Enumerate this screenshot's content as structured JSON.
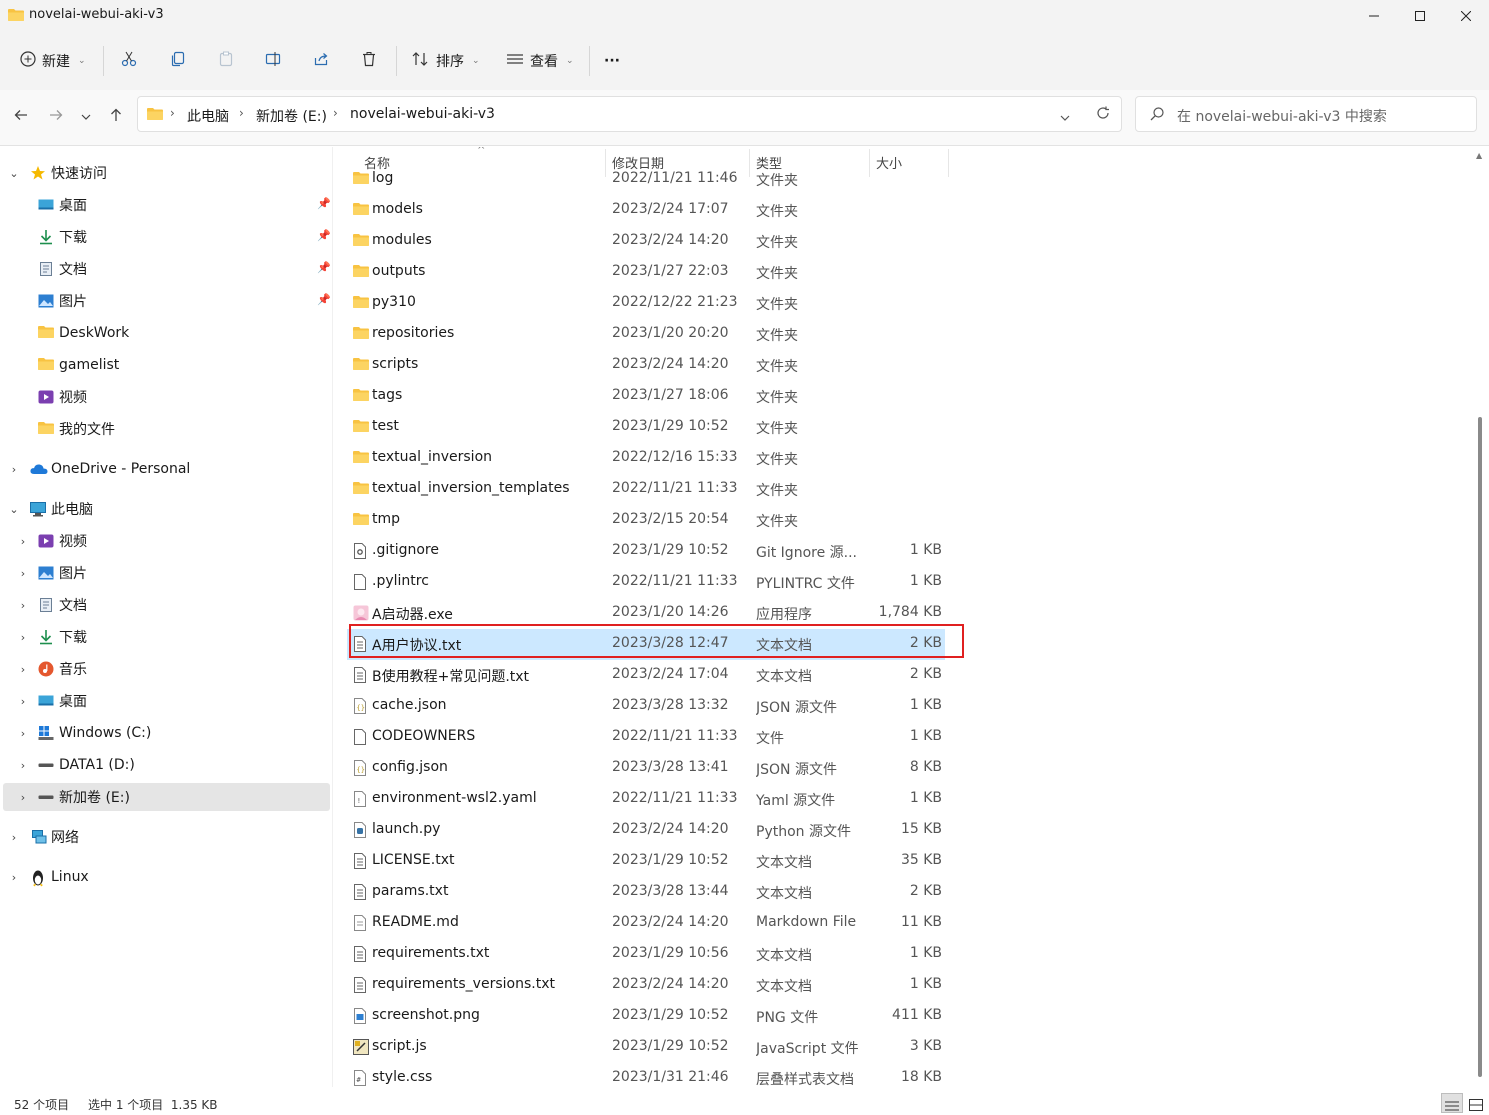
{
  "window": {
    "title": "novelai-webui-aki-v3"
  },
  "commandbar": {
    "new_label": "新建",
    "sort_label": "排序",
    "view_label": "查看",
    "more_label": "···"
  },
  "address": {
    "crumbs": [
      "此电脑",
      "新加卷 (E:)",
      "novelai-webui-aki-v3"
    ],
    "search_placeholder": "在 novelai-webui-aki-v3 中搜索"
  },
  "sidebar": {
    "quick_access": "快速访问",
    "quick_items": [
      "桌面",
      "下载",
      "文档",
      "图片",
      "DeskWork",
      "gamelist",
      "视频",
      "我的文件"
    ],
    "onedrive": "OneDrive - Personal",
    "this_pc": "此电脑",
    "pc_items": [
      "视频",
      "图片",
      "文档",
      "下载",
      "音乐",
      "桌面",
      "Windows (C:)",
      "DATA1 (D:)",
      "新加卷 (E:)"
    ],
    "network": "网络",
    "linux": "Linux"
  },
  "columns": {
    "name": "名称",
    "date": "修改日期",
    "type": "类型",
    "size": "大小"
  },
  "files": [
    {
      "name": "log",
      "date": "2022/11/21 11:46",
      "type": "文件夹",
      "size": "",
      "icon": "folder-icon"
    },
    {
      "name": "models",
      "date": "2023/2/24 17:07",
      "type": "文件夹",
      "size": "",
      "icon": "folder-icon"
    },
    {
      "name": "modules",
      "date": "2023/2/24 14:20",
      "type": "文件夹",
      "size": "",
      "icon": "folder-icon"
    },
    {
      "name": "outputs",
      "date": "2023/1/27 22:03",
      "type": "文件夹",
      "size": "",
      "icon": "folder-icon"
    },
    {
      "name": "py310",
      "date": "2022/12/22 21:23",
      "type": "文件夹",
      "size": "",
      "icon": "folder-icon"
    },
    {
      "name": "repositories",
      "date": "2023/1/20 20:20",
      "type": "文件夹",
      "size": "",
      "icon": "folder-icon"
    },
    {
      "name": "scripts",
      "date": "2023/2/24 14:20",
      "type": "文件夹",
      "size": "",
      "icon": "folder-icon"
    },
    {
      "name": "tags",
      "date": "2023/1/27 18:06",
      "type": "文件夹",
      "size": "",
      "icon": "folder-icon"
    },
    {
      "name": "test",
      "date": "2023/1/29 10:52",
      "type": "文件夹",
      "size": "",
      "icon": "folder-icon"
    },
    {
      "name": "textual_inversion",
      "date": "2022/12/16 15:33",
      "type": "文件夹",
      "size": "",
      "icon": "folder-icon"
    },
    {
      "name": "textual_inversion_templates",
      "date": "2022/11/21 11:33",
      "type": "文件夹",
      "size": "",
      "icon": "folder-icon"
    },
    {
      "name": "tmp",
      "date": "2023/2/15 20:54",
      "type": "文件夹",
      "size": "",
      "icon": "folder-icon"
    },
    {
      "name": ".gitignore",
      "date": "2023/1/29 10:52",
      "type": "Git Ignore 源...",
      "size": "1 KB",
      "icon": "gear-file-icon"
    },
    {
      "name": ".pylintrc",
      "date": "2022/11/21 11:33",
      "type": "PYLINTRC 文件",
      "size": "1 KB",
      "icon": "blank-file-icon"
    },
    {
      "name": "A启动器.exe",
      "date": "2023/1/20 14:26",
      "type": "应用程序",
      "size": "1,784 KB",
      "icon": "app-icon"
    },
    {
      "name": "A用户协议.txt",
      "date": "2023/3/28 12:47",
      "type": "文本文档",
      "size": "2 KB",
      "icon": "text-file-icon"
    },
    {
      "name": "B使用教程+常见问题.txt",
      "date": "2023/2/24 17:04",
      "type": "文本文档",
      "size": "2 KB",
      "icon": "text-file-icon"
    },
    {
      "name": "cache.json",
      "date": "2023/3/28 13:32",
      "type": "JSON 源文件",
      "size": "1 KB",
      "icon": "json-file-icon"
    },
    {
      "name": "CODEOWNERS",
      "date": "2022/11/21 11:33",
      "type": "文件",
      "size": "1 KB",
      "icon": "blank-file-icon"
    },
    {
      "name": "config.json",
      "date": "2023/3/28 13:41",
      "type": "JSON 源文件",
      "size": "8 KB",
      "icon": "json-file-icon"
    },
    {
      "name": "environment-wsl2.yaml",
      "date": "2022/11/21 11:33",
      "type": "Yaml 源文件",
      "size": "1 KB",
      "icon": "yaml-file-icon"
    },
    {
      "name": "launch.py",
      "date": "2023/2/24 14:20",
      "type": "Python 源文件",
      "size": "15 KB",
      "icon": "python-file-icon"
    },
    {
      "name": "LICENSE.txt",
      "date": "2023/1/29 10:52",
      "type": "文本文档",
      "size": "35 KB",
      "icon": "text-file-icon"
    },
    {
      "name": "params.txt",
      "date": "2023/3/28 13:44",
      "type": "文本文档",
      "size": "2 KB",
      "icon": "text-file-icon"
    },
    {
      "name": "README.md",
      "date": "2023/2/24 14:20",
      "type": "Markdown File",
      "size": "11 KB",
      "icon": "markdown-file-icon"
    },
    {
      "name": "requirements.txt",
      "date": "2023/1/29 10:56",
      "type": "文本文档",
      "size": "1 KB",
      "icon": "text-file-icon"
    },
    {
      "name": "requirements_versions.txt",
      "date": "2023/2/24 14:20",
      "type": "文本文档",
      "size": "1 KB",
      "icon": "text-file-icon"
    },
    {
      "name": "screenshot.png",
      "date": "2023/1/29 10:52",
      "type": "PNG 文件",
      "size": "411 KB",
      "icon": "image-file-icon"
    },
    {
      "name": "script.js",
      "date": "2023/1/29 10:52",
      "type": "JavaScript 文件",
      "size": "3 KB",
      "icon": "js-file-icon"
    },
    {
      "name": "style.css",
      "date": "2023/1/31 21:46",
      "type": "层叠样式表文档",
      "size": "18 KB",
      "icon": "css-file-icon"
    }
  ],
  "selected_file": "A用户协议.txt",
  "status": {
    "count": "52 个项目",
    "selection": "选中 1 个项目  1.35 KB"
  },
  "colors": {
    "selection": "#cce8ff",
    "highlight_border": "#e02020",
    "folder": "#f8c342"
  }
}
